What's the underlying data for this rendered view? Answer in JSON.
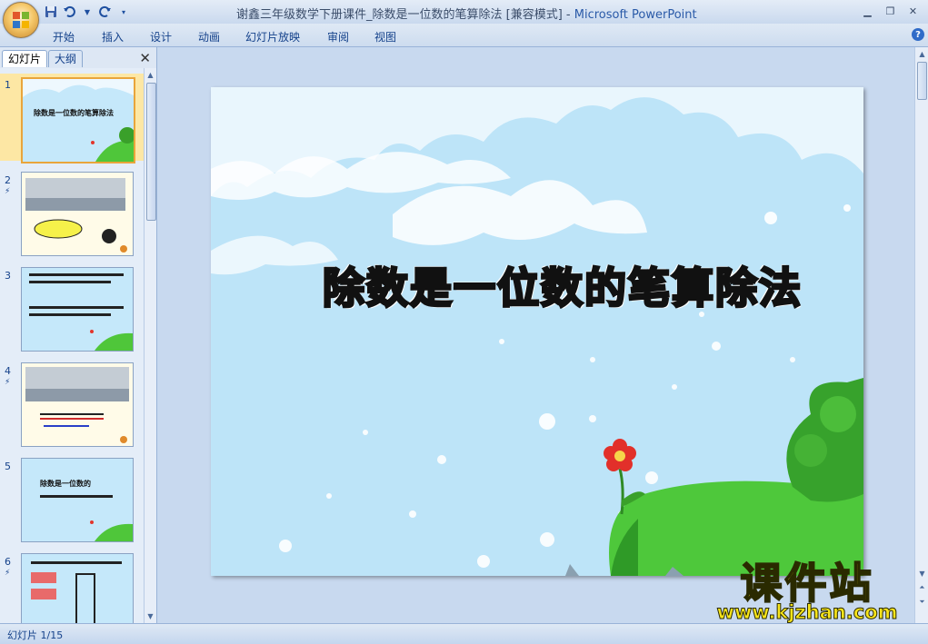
{
  "window": {
    "title": "谢鑫三年级数学下册课件_除数是一位数的笔算除法 [兼容模式] - ",
    "app_name": "Microsoft PowerPoint"
  },
  "ribbon": {
    "tabs": [
      "开始",
      "插入",
      "设计",
      "动画",
      "幻灯片放映",
      "审阅",
      "视图"
    ]
  },
  "panel": {
    "tab_slides": "幻灯片",
    "tab_outline": "大纲",
    "slides": [
      {
        "num": "1",
        "anim": "",
        "title": "除数是一位数的笔算除法"
      },
      {
        "num": "2",
        "anim": "⚡",
        "title": ""
      },
      {
        "num": "3",
        "anim": "",
        "title": ""
      },
      {
        "num": "4",
        "anim": "⚡",
        "title": ""
      },
      {
        "num": "5",
        "anim": "",
        "title": "除数是一位数的"
      },
      {
        "num": "6",
        "anim": "⚡",
        "title": ""
      }
    ]
  },
  "slide": {
    "title": "除数是一位数的笔算除法"
  },
  "status": {
    "text": "幻灯片 1/15"
  },
  "watermark": {
    "cn": "课件站",
    "url": "www.kjzhan.com"
  }
}
